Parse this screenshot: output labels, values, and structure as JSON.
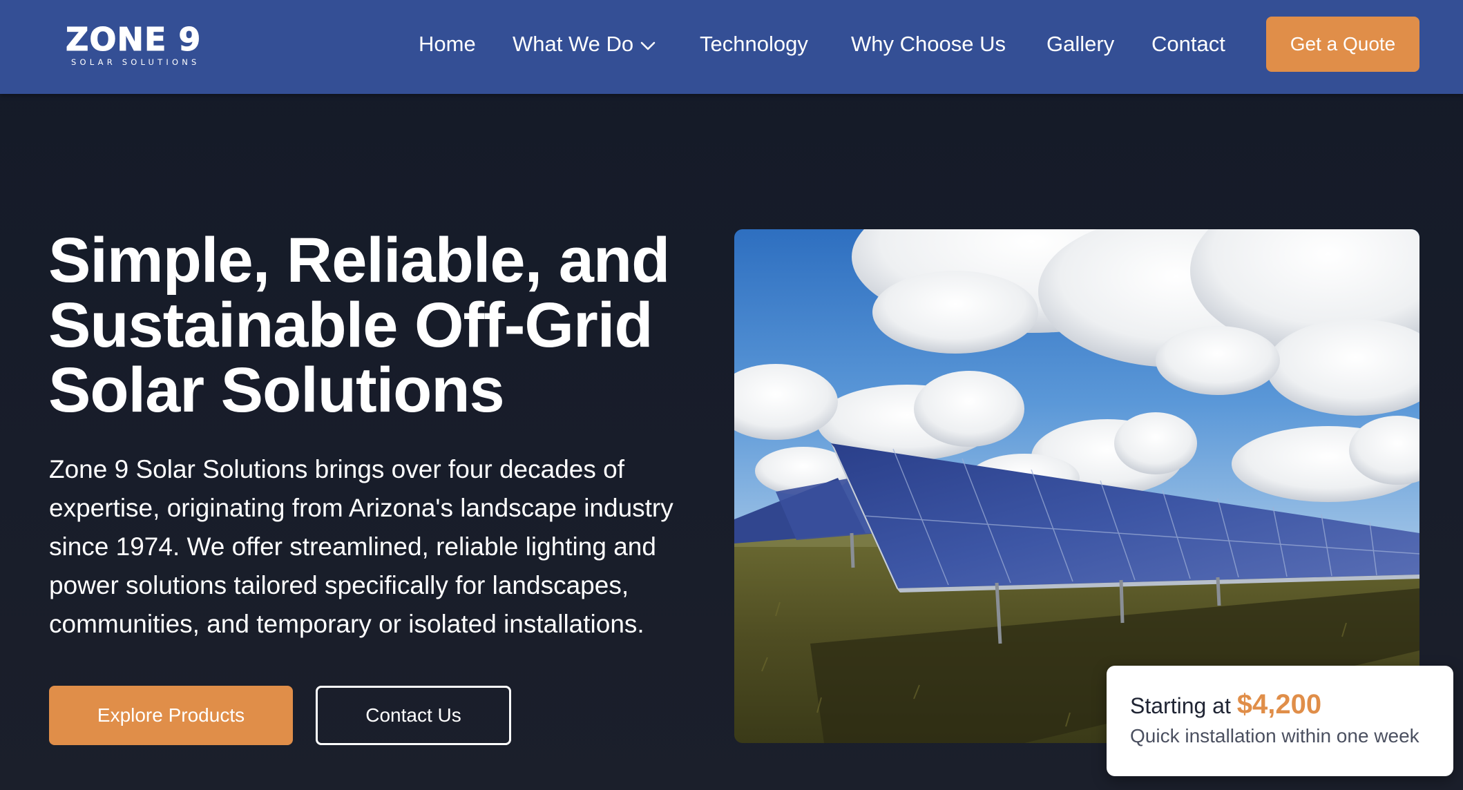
{
  "brand": {
    "name": "ZONE 9",
    "tagline": "SOLAR SOLUTIONS"
  },
  "nav": {
    "items": [
      {
        "label": "Home"
      },
      {
        "label": "What We Do",
        "icon": "chevron-down-icon"
      },
      {
        "label": "Technology"
      },
      {
        "label": "Why Choose Us"
      },
      {
        "label": "Gallery"
      },
      {
        "label": "Contact"
      }
    ],
    "cta_label": "Get a Quote"
  },
  "hero": {
    "title_lines": [
      "Simple, Reliable, and",
      "Sustainable Off-Grid",
      "Solar Solutions"
    ],
    "description_lines": [
      "Zone 9 Solar Solutions brings over four decades of",
      "expertise, originating from Arizona's landscape industry",
      "since 1974. We offer streamlined, reliable lighting and",
      "power solutions tailored specifically for landscapes,",
      "communities, and temporary or isolated installations."
    ],
    "primary_button": "Explore Products",
    "secondary_button": "Contact Us",
    "image_subject": "solar panel array in grass field under cloudy blue sky"
  },
  "price_card": {
    "prefix": "Starting at",
    "amount": "$4,200",
    "note": "Quick installation within one week"
  },
  "colors": {
    "nav_bg": "#344f95",
    "page_bg": "#1a1f2c",
    "accent": "#e08e49",
    "text": "#ffffff"
  }
}
